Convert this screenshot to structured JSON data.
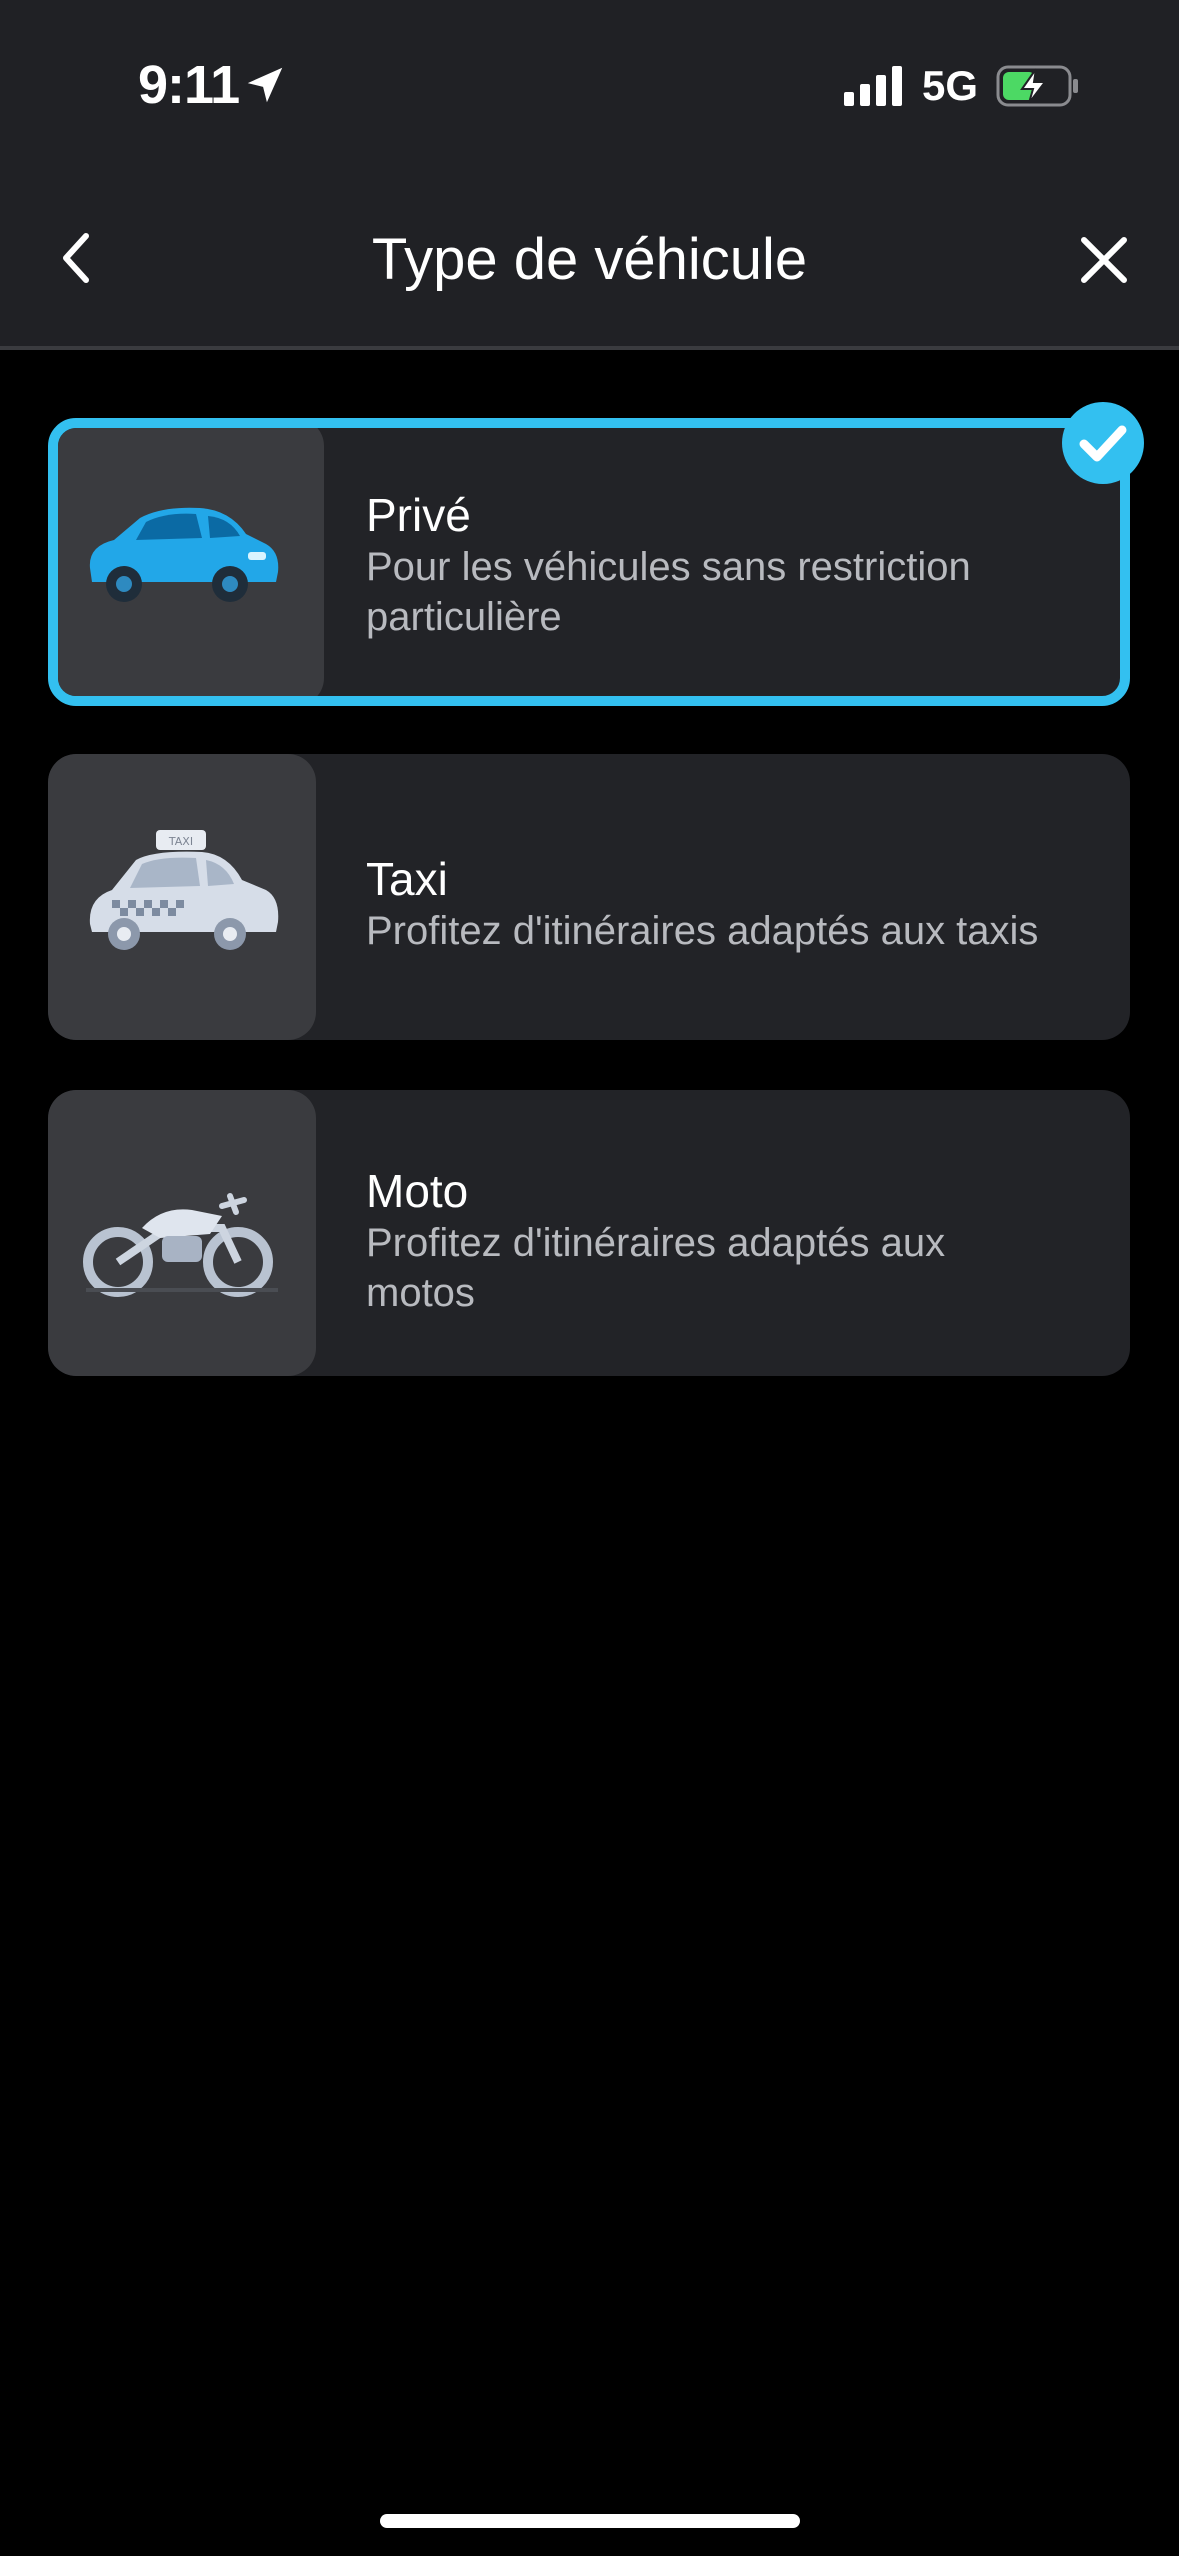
{
  "status_bar": {
    "time": "9:11",
    "network": "5G",
    "icons": [
      "location-arrow-icon",
      "signal-bars-icon",
      "battery-charging-icon"
    ]
  },
  "header": {
    "title": "Type de véhicule",
    "back_icon": "chevron-left-icon",
    "close_icon": "close-icon"
  },
  "options": [
    {
      "name": "Privé",
      "description": "Pour les véhicules sans restriction particulière",
      "icon": "car-icon",
      "selected": true
    },
    {
      "name": "Taxi",
      "description": "Profitez d'itinéraires adaptés aux taxis",
      "icon": "taxi-icon",
      "selected": false
    },
    {
      "name": "Moto",
      "description": "Profitez d'itinéraires adaptés aux motos",
      "icon": "motorcycle-icon",
      "selected": false
    }
  ],
  "colors": {
    "accent": "#33c0f0",
    "background": "#000000",
    "surface": "#222327",
    "header": "#202125",
    "text_secondary": "#b8babf"
  }
}
